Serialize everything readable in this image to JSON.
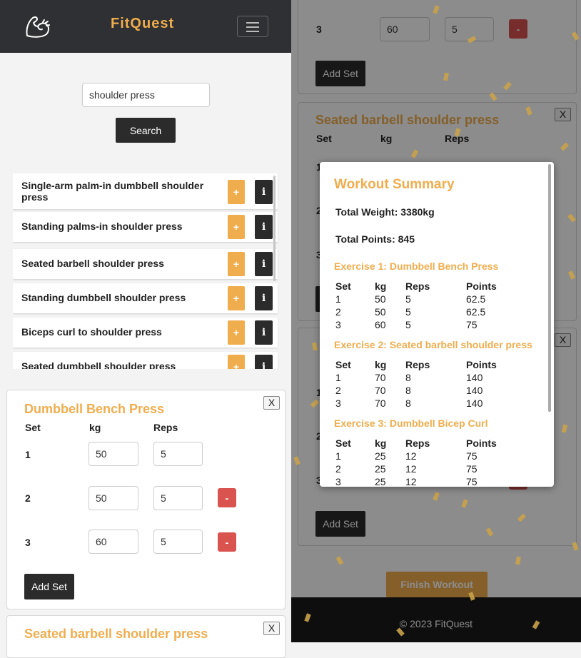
{
  "app": {
    "brand": "FitQuest",
    "footer": "© 2023 FitQuest"
  },
  "search": {
    "value": "shoulder press",
    "button": "Search"
  },
  "results": [
    {
      "name": "Single-arm palm-in dumbbell shoulder press"
    },
    {
      "name": "Standing palms-in shoulder press"
    },
    {
      "name": "Seated barbell shoulder press"
    },
    {
      "name": "Standing dumbbell shoulder press"
    },
    {
      "name": "Biceps curl to shoulder press"
    },
    {
      "name": "Seated dumbbell shoulder press"
    }
  ],
  "result_buttons": {
    "add": "+",
    "info": "i"
  },
  "labels": {
    "set": "Set",
    "kg": "kg",
    "reps": "Reps",
    "points": "Points",
    "add_set": "Add Set",
    "close": "X",
    "remove": "-",
    "finish": "Finish Workout"
  },
  "workout": [
    {
      "name": "Dumbbell Bench Press",
      "sets": [
        {
          "set": "1",
          "kg": "50",
          "reps": "5"
        },
        {
          "set": "2",
          "kg": "50",
          "reps": "5"
        },
        {
          "set": "3",
          "kg": "60",
          "reps": "5"
        }
      ]
    },
    {
      "name": "Seated barbell shoulder press",
      "sets": []
    }
  ],
  "background_visible": {
    "top_row": {
      "set": "3",
      "kg": "60",
      "reps": "5"
    },
    "card_title": "Seated barbell shoulder press",
    "set_numbers": [
      "1",
      "2",
      "3"
    ]
  },
  "summary": {
    "title": "Workout Summary",
    "total_weight": "Total Weight: 3380kg",
    "total_points": "Total Points: 845",
    "exercises": [
      {
        "title": "Exercise 1: Dumbbell Bench Press",
        "rows": [
          {
            "set": "1",
            "kg": "50",
            "reps": "5",
            "points": "62.5"
          },
          {
            "set": "2",
            "kg": "50",
            "reps": "5",
            "points": "62.5"
          },
          {
            "set": "3",
            "kg": "60",
            "reps": "5",
            "points": "75"
          }
        ]
      },
      {
        "title": "Exercise 2: Seated barbell shoulder press",
        "rows": [
          {
            "set": "1",
            "kg": "70",
            "reps": "8",
            "points": "140"
          },
          {
            "set": "2",
            "kg": "70",
            "reps": "8",
            "points": "140"
          },
          {
            "set": "3",
            "kg": "70",
            "reps": "8",
            "points": "140"
          }
        ]
      },
      {
        "title": "Exercise 3: Dumbbell Bicep Curl",
        "rows": [
          {
            "set": "1",
            "kg": "25",
            "reps": "12",
            "points": "75"
          },
          {
            "set": "2",
            "kg": "25",
            "reps": "12",
            "points": "75"
          },
          {
            "set": "3",
            "kg": "25",
            "reps": "12",
            "points": "75"
          }
        ]
      }
    ]
  },
  "colors": {
    "accent": "#f0ad4e",
    "danger": "#d9534f",
    "dark": "#2f3033"
  }
}
